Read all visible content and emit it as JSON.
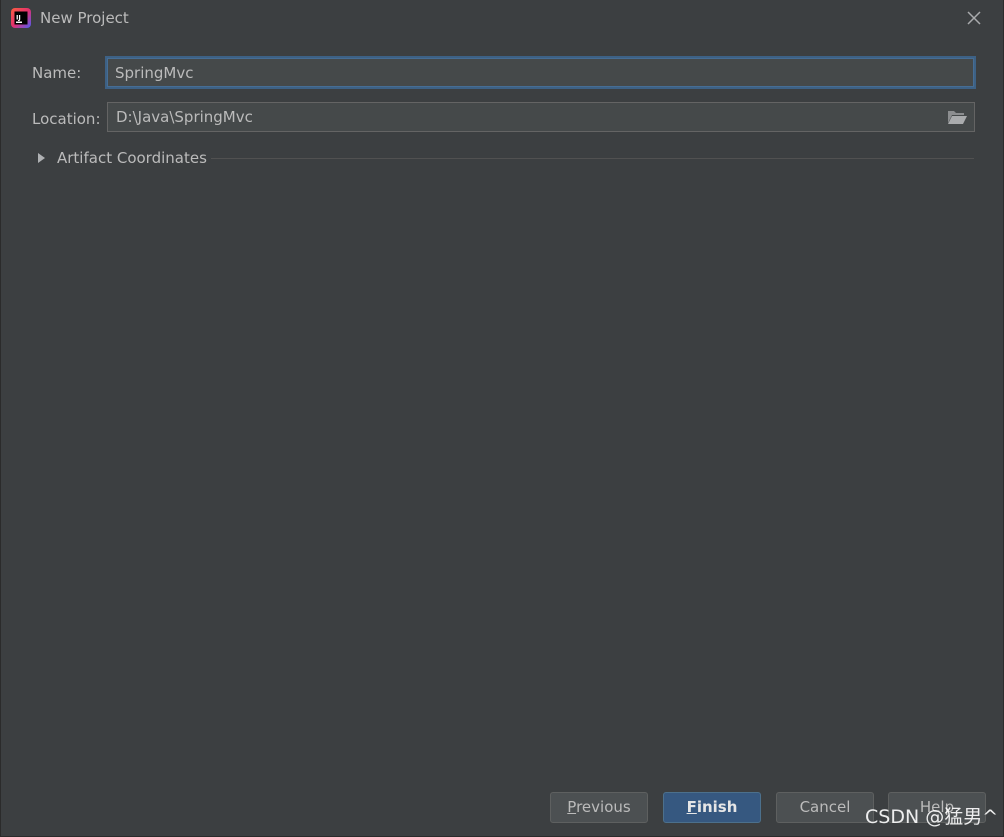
{
  "window": {
    "title": "New Project",
    "app_icon": "intellij-idea-icon",
    "close_icon": "close-icon"
  },
  "form": {
    "name_label": "Name:",
    "name_value": "SpringMvc",
    "location_label": "Location:",
    "location_value": "D:\\Java\\SpringMvc",
    "browse_icon": "folder-open-icon"
  },
  "artifact": {
    "label": "Artifact Coordinates",
    "expanded": false
  },
  "buttons": {
    "previous_mnemonic": "P",
    "previous_rest": "revious",
    "finish_mnemonic": "F",
    "finish_rest": "inish",
    "cancel": "Cancel",
    "help": "Help"
  },
  "watermark": "CSDN @猛男^",
  "colors": {
    "background": "#3c3f41",
    "field_background": "#45494a",
    "focus_border": "#3d6185",
    "default_button": "#365880",
    "text": "#bbbbbb"
  }
}
